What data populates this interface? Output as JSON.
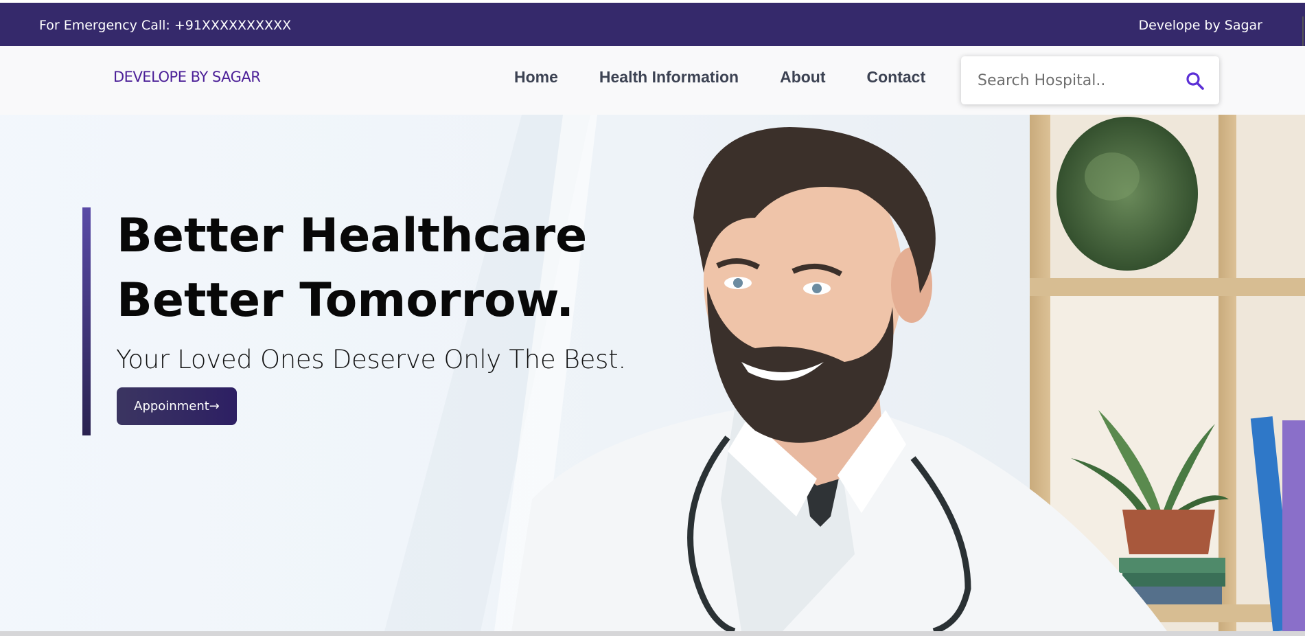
{
  "topbar": {
    "emergency": "For Emergency Call: +91XXXXXXXXXX",
    "credit": "Develope by Sagar"
  },
  "navbar": {
    "logo": "DEVELOPE BY SAGAR",
    "links": [
      "Home",
      "Health Information",
      "About",
      "Contact"
    ],
    "search_placeholder": "Search Hospital.."
  },
  "hero": {
    "headline_line1": "Better Healthcare",
    "headline_line2": "Better Tomorrow.",
    "subline": "Your Loved Ones Deserve Only The Best.",
    "cta_label": "Appoinment→"
  },
  "colors": {
    "topbar_bg": "#35296b",
    "logo": "#4b1f97",
    "search_icon": "#5b2fd6",
    "cta_bg": "#2d1f63"
  },
  "icons": [
    "search-icon"
  ]
}
